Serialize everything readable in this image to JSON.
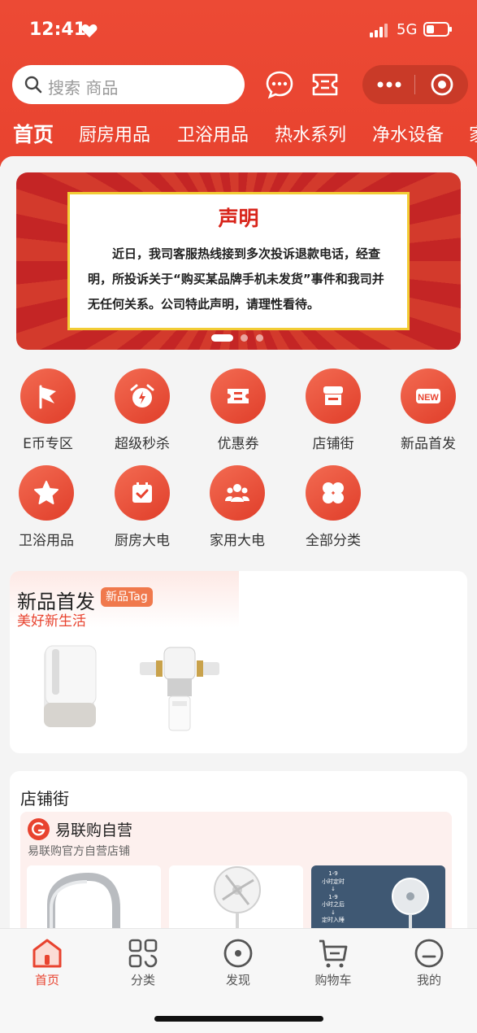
{
  "status_bar": {
    "time": "12:41",
    "network": "5G"
  },
  "search": {
    "placeholder": "搜索 商品"
  },
  "tabs": [
    {
      "label": "首页",
      "active": true
    },
    {
      "label": "厨房用品"
    },
    {
      "label": "卫浴用品"
    },
    {
      "label": "热水系列"
    },
    {
      "label": "净水设备"
    },
    {
      "label": "家"
    }
  ],
  "banner": {
    "title": "声明",
    "body": "近日，我司客服热线接到多次投诉退款电话，经查明，所投诉关于“购买某品牌手机未发货”事件和我司并无任何关系。公司特此声明，请理性看待。"
  },
  "grid": [
    {
      "label": "E币专区",
      "icon": "flag-icon"
    },
    {
      "label": "超级秒杀",
      "icon": "alarm-clock-icon"
    },
    {
      "label": "优惠券",
      "icon": "coupon-icon"
    },
    {
      "label": "店铺街",
      "icon": "shop-icon"
    },
    {
      "label": "新品首发",
      "icon": "new-badge-icon"
    },
    {
      "label": "卫浴用品",
      "icon": "star-icon"
    },
    {
      "label": "厨房大电",
      "icon": "calendar-check-icon"
    },
    {
      "label": "家用大电",
      "icon": "people-icon"
    },
    {
      "label": "全部分类",
      "icon": "four-leaf-icon"
    }
  ],
  "new_products": {
    "title": "新品首发",
    "tag": "新品Tag",
    "subtitle": "美好新生活"
  },
  "shop_street": {
    "title": "店铺街",
    "shop_name": "易联购自营",
    "shop_desc": "易联购官方自营店铺",
    "logo_text": "易联购",
    "promo_lines": [
      "1-9",
      "小时定时",
      "↓",
      "1-9",
      "小时之后",
      "↓",
      "定时入睡"
    ]
  },
  "bottom_nav": [
    {
      "label": "首页",
      "icon": "home-icon",
      "active": true
    },
    {
      "label": "分类",
      "icon": "category-icon"
    },
    {
      "label": "发现",
      "icon": "discover-icon"
    },
    {
      "label": "购物车",
      "icon": "cart-icon"
    },
    {
      "label": "我的",
      "icon": "profile-icon"
    }
  ],
  "colors": {
    "primary": "#e8432f",
    "tag": "#f0794c",
    "notice_border": "#f2cc35",
    "notice_title": "#d8251b"
  }
}
